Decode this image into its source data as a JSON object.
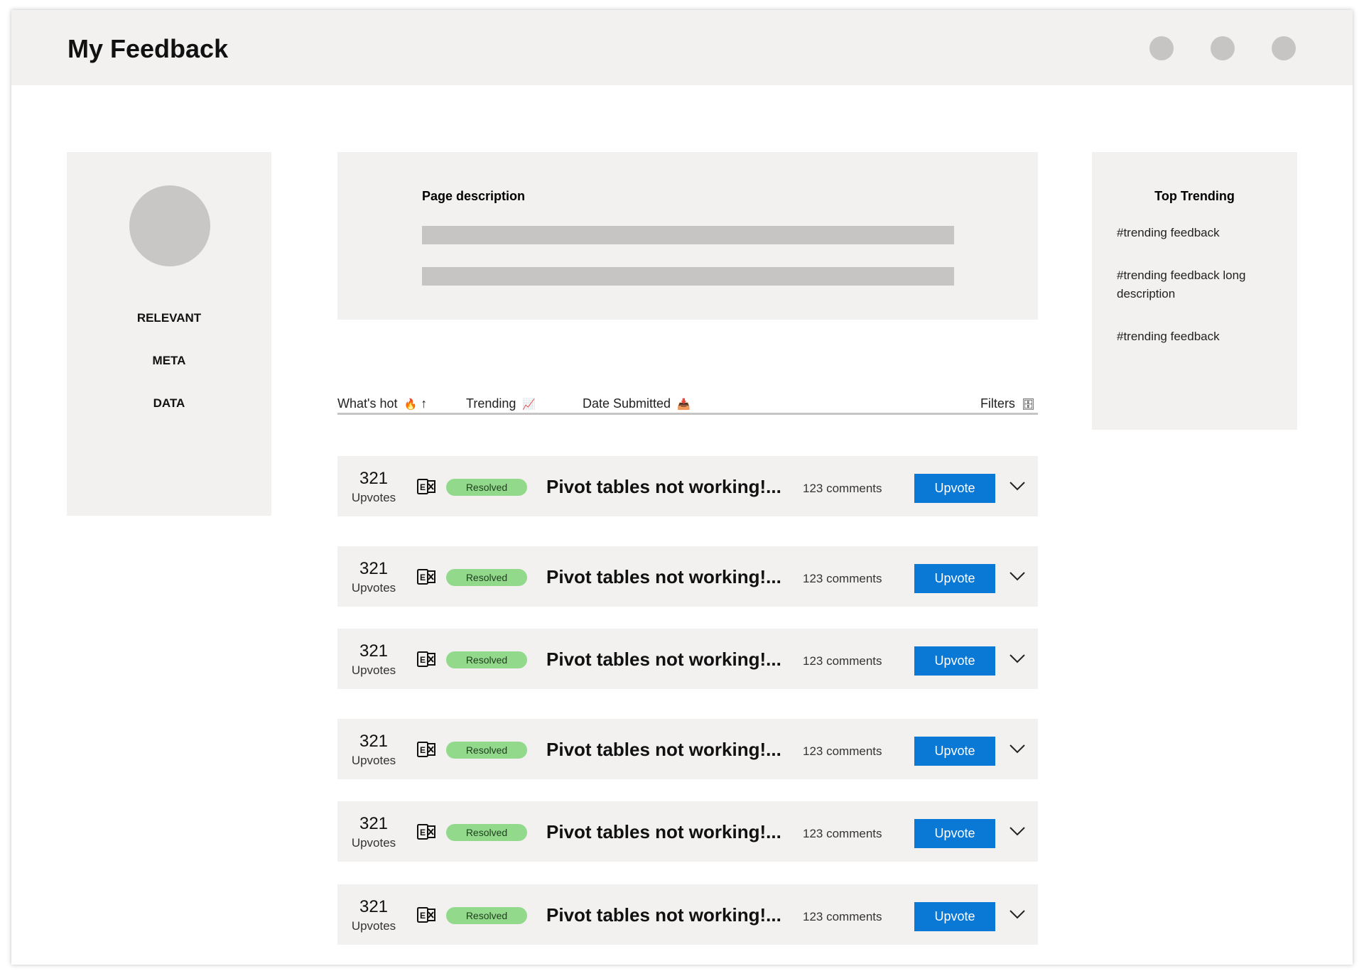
{
  "header": {
    "title": "My Feedback",
    "dots": [
      "profile-dot",
      "settings-dot",
      "menu-dot"
    ]
  },
  "left_panel": {
    "labels": [
      "RELEVANT",
      "META",
      "DATA"
    ]
  },
  "description": {
    "title": "Page description"
  },
  "tabs": [
    {
      "label": "What's hot",
      "icon": "🔥",
      "extra": "↑"
    },
    {
      "label": "Trending",
      "icon": "📈"
    },
    {
      "label": "Date Submitted",
      "icon": "📥"
    },
    {
      "label": "Filters",
      "icon": "🗄"
    }
  ],
  "trending": {
    "title": "Top Trending",
    "items": [
      "#trending feedback",
      "#trending feedback long description",
      "#trending feedback"
    ]
  },
  "feedback": [
    {
      "votes": "321",
      "votes_label": "Upvotes",
      "status": "Resolved",
      "title": "Pivot tables not working!...",
      "comments": "123 comments",
      "button": "Upvote"
    },
    {
      "votes": "321",
      "votes_label": "Upvotes",
      "status": "Resolved",
      "title": "Pivot tables not working!...",
      "comments": "123 comments",
      "button": "Upvote"
    },
    {
      "votes": "321",
      "votes_label": "Upvotes",
      "status": "Resolved",
      "title": "Pivot tables not working!...",
      "comments": "123 comments",
      "button": "Upvote"
    },
    {
      "votes": "321",
      "votes_label": "Upvotes",
      "status": "Resolved",
      "title": "Pivot tables not working!...",
      "comments": "123 comments",
      "button": "Upvote"
    },
    {
      "votes": "321",
      "votes_label": "Upvotes",
      "status": "Resolved",
      "title": "Pivot tables not working!...",
      "comments": "123 comments",
      "button": "Upvote"
    },
    {
      "votes": "321",
      "votes_label": "Upvotes",
      "status": "Resolved",
      "title": "Pivot tables not working!...",
      "comments": "123 comments",
      "button": "Upvote"
    }
  ],
  "colors": {
    "accent": "#0a78d5",
    "badge": "#92d98c",
    "panel": "#f2f1f0",
    "placeholder": "#c7c5c3"
  }
}
